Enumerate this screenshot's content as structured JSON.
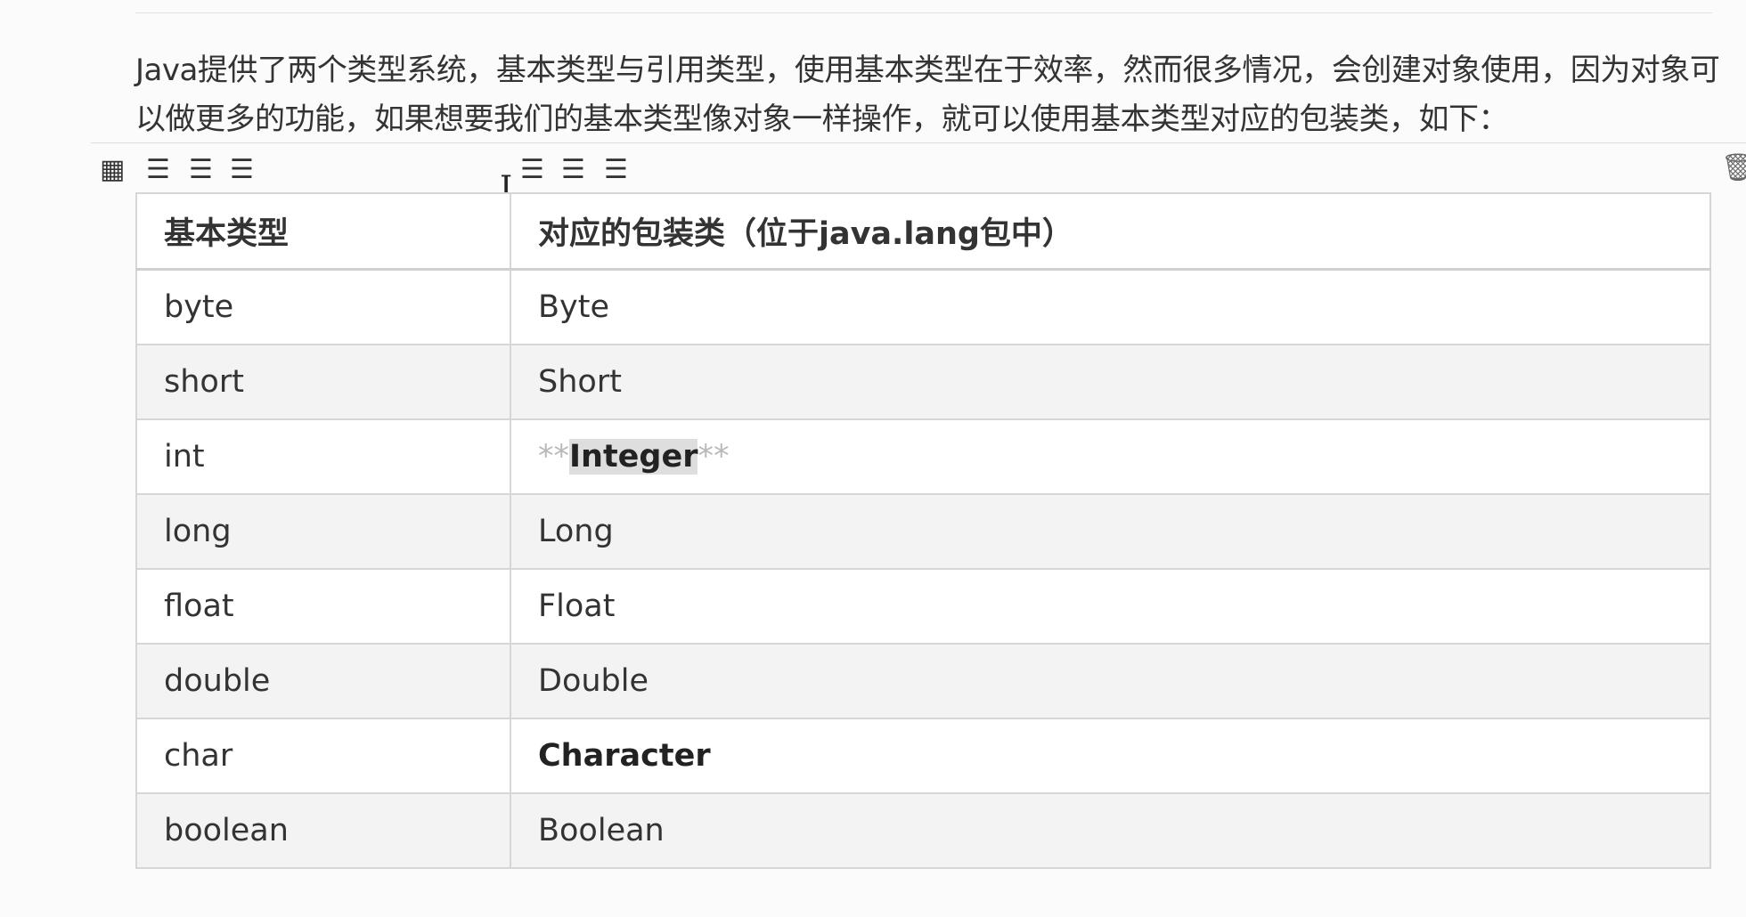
{
  "paragraph": "Java提供了两个类型系统，基本类型与引用类型，使用基本类型在于效率，然而很多情况，会创建对象使用，因为对象可以做更多的功能，如果想要我们的基本类型像对象一样操作，就可以使用基本类型对应的包装类，如下：",
  "toolbar": {
    "table_icon": "grid-icon",
    "align_left_icon": "align-left-icon",
    "align_center_icon": "align-center-icon",
    "align_right_icon": "align-right-icon",
    "delete_icon": "trash-icon"
  },
  "table": {
    "headers": [
      "基本类型",
      "对应的包装类（位于java.lang包中）"
    ],
    "rows": [
      [
        "byte",
        "Byte"
      ],
      [
        "short",
        "Short"
      ],
      [
        "int",
        "Integer"
      ],
      [
        "long",
        "Long"
      ],
      [
        "float",
        "Float"
      ],
      [
        "double",
        "Double"
      ],
      [
        "char",
        "Character"
      ],
      [
        "boolean",
        "Boolean"
      ]
    ],
    "int_markdown_prefix": "**",
    "int_markdown_suffix": "**"
  },
  "colors": {
    "border": "#d6d6d6",
    "stripe": "#f3f3f3",
    "text": "#333333",
    "markdown_mark": "#b9b9b9",
    "highlight": "#dedede"
  }
}
